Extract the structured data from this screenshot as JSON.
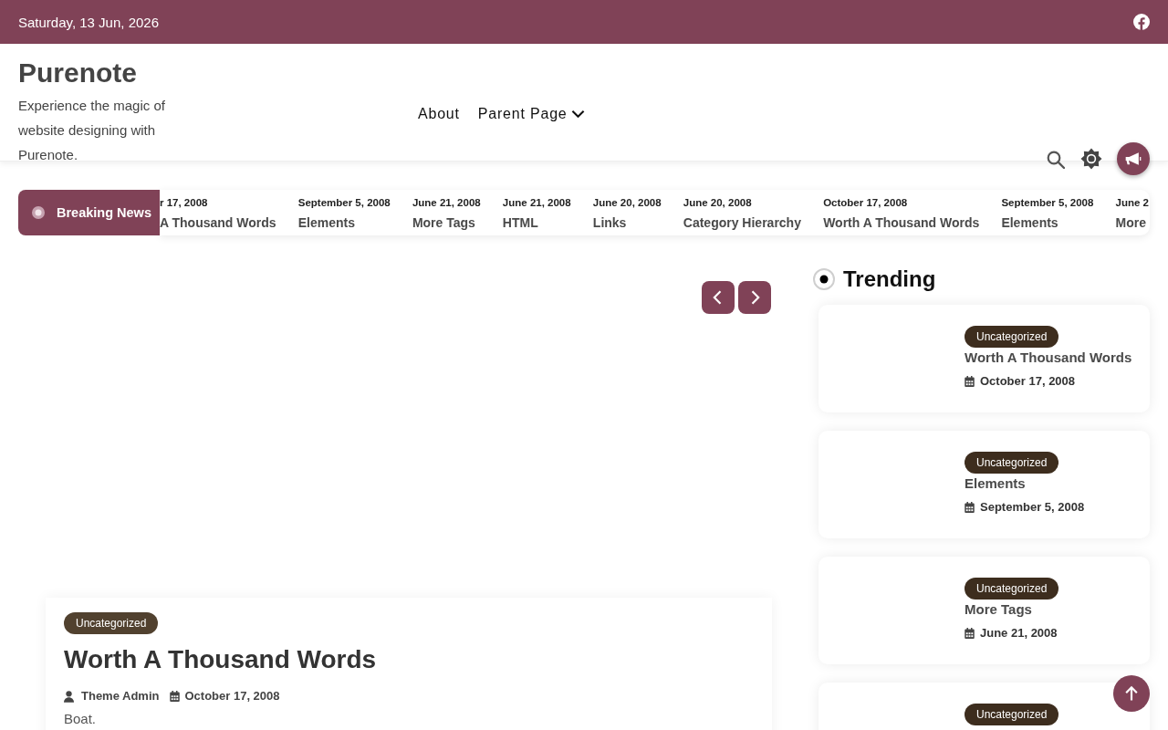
{
  "top_bar": {
    "date": "Saturday, 13 Jun, 2026"
  },
  "site": {
    "title": "Purenote",
    "tagline": "Experience the magic of website designing with Purenote."
  },
  "nav": [
    {
      "label": "About",
      "has_submenu": false
    },
    {
      "label": "Parent Page",
      "has_submenu": true
    }
  ],
  "breaking_news": {
    "label": "Breaking News",
    "items": [
      {
        "date": "r 17, 2008",
        "title": "A Thousand Words"
      },
      {
        "date": "September 5, 2008",
        "title": "Elements"
      },
      {
        "date": "June 21, 2008",
        "title": "More Tags"
      },
      {
        "date": "June 21, 2008",
        "title": "HTML"
      },
      {
        "date": "June 20, 2008",
        "title": "Links"
      },
      {
        "date": "June 20, 2008",
        "title": "Category Hierarchy"
      },
      {
        "date": "October 17, 2008",
        "title": "Worth A Thousand Words"
      },
      {
        "date": "September 5, 2008",
        "title": "Elements"
      },
      {
        "date": "June 2",
        "title": "More"
      }
    ]
  },
  "featured_post": {
    "category": "Uncategorized",
    "title": "Worth A Thousand Words",
    "author": "Theme Admin",
    "date": "October 17, 2008",
    "excerpt": "Boat."
  },
  "trending": {
    "title": "Trending",
    "posts": [
      {
        "category": "Uncategorized",
        "title": "Worth A Thousand Words",
        "date": "October 17, 2008"
      },
      {
        "category": "Uncategorized",
        "title": "Elements",
        "date": "September 5, 2008"
      },
      {
        "category": "Uncategorized",
        "title": "More Tags",
        "date": "June 21, 2008"
      },
      {
        "category": "Uncategorized"
      }
    ]
  }
}
